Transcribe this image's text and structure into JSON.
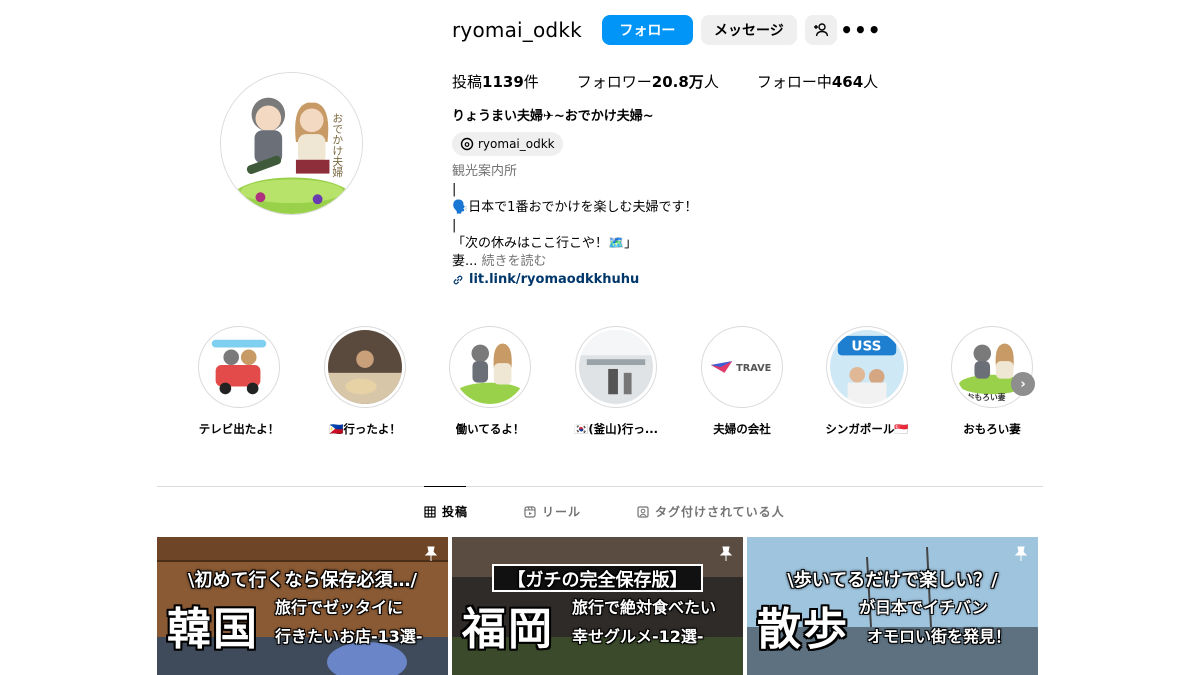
{
  "profile": {
    "username": "ryomai_odkk",
    "follow_label": "フォロー",
    "message_label": "メッセージ",
    "add_user_icon": "person-add-icon",
    "more_icon": "more-options-icon",
    "avatar_text": "おでかけ夫婦"
  },
  "stats": {
    "posts_label": "投稿",
    "posts_count": "1139",
    "posts_unit": "件",
    "followers_label": "フォロワー",
    "followers_count": "20.8万",
    "followers_unit": "人",
    "following_label": "フォロー中",
    "following_count": "464",
    "following_unit": "人"
  },
  "bio": {
    "name": "りょうまい夫婦✈︎~おでかけ夫婦~",
    "threads_handle": "ryomai_odkk",
    "category": "観光案内所",
    "sep1": "|",
    "line1": "🗣️日本で1番おでかけを楽しむ夫婦です！",
    "sep2": "|",
    "line2": "「次の休みはここ行こや！🗺️」",
    "line3": "妻...",
    "more_label": "続きを読む",
    "link": "lit.link/ryomaodkkhuhu"
  },
  "highlights": [
    {
      "label": "テレビ出たよ！"
    },
    {
      "label": "🇵🇭行ったよ！"
    },
    {
      "label": "働いてるよ！"
    },
    {
      "label": "🇰🇷(釜山)行っ..."
    },
    {
      "label": "夫婦の会社",
      "inner_text": "TRAVE"
    },
    {
      "label": "シンガポール🇸🇬",
      "inner_text": "USS"
    },
    {
      "label": "おもろい妻",
      "inner_text": "おもろい妻"
    }
  ],
  "tabs": [
    {
      "label": "投稿",
      "icon": "grid-icon",
      "active": true
    },
    {
      "label": "リール",
      "icon": "reels-icon",
      "active": false
    },
    {
      "label": "タグ付けされている人",
      "icon": "tagged-icon",
      "active": false
    }
  ],
  "posts": [
    {
      "top": "\\初めて行くなら保存必須…/",
      "big": "韓国",
      "sub1": "旅行でゼッタイに",
      "sub2": "行きたいお店-13選-"
    },
    {
      "top": "【ガチの完全保存版】",
      "big": "福岡",
      "sub1": "旅行で絶対食べたい",
      "sub2": "幸せグルメ-12選-"
    },
    {
      "top": "\\歩いてるだけで楽しい？/",
      "big": "散歩",
      "sub1": "が日本でイチバン",
      "sub2": "オモロい街を発見！"
    }
  ],
  "colors": {
    "follow_blue": "#0095f6",
    "button_gray": "#efefef",
    "link_blue": "#00376b",
    "muted_text": "#737373"
  }
}
